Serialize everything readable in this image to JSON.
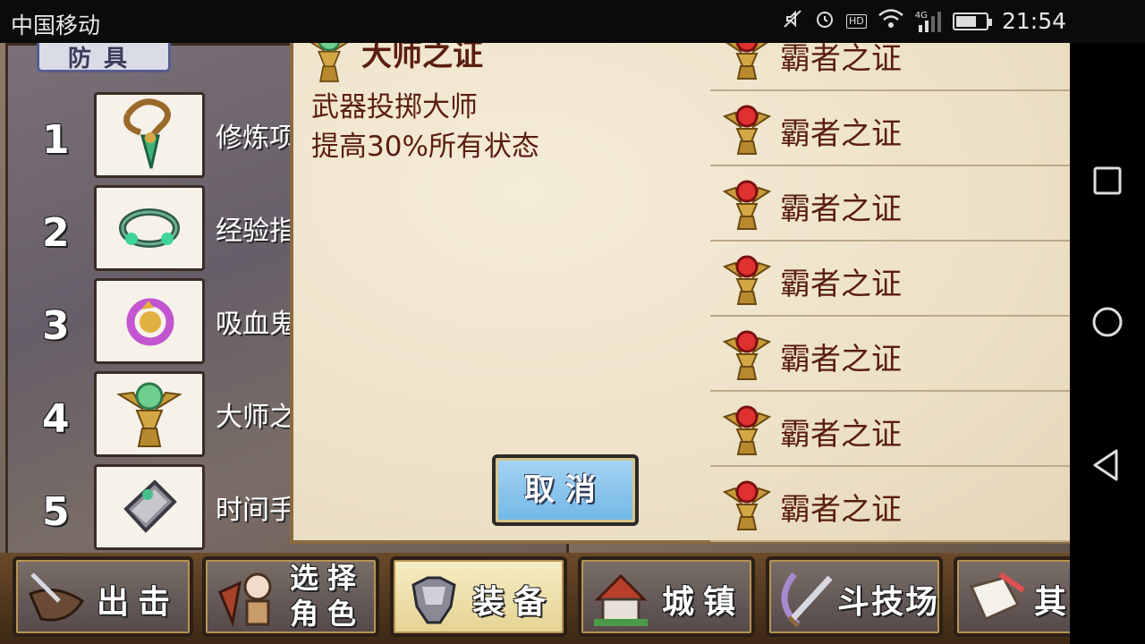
{
  "status_bar": {
    "carrier": "中国移动",
    "network": "4G",
    "hd": "HD",
    "battery_level": 0.7,
    "time": "21:54"
  },
  "left_panel": {
    "tab_label": "防具",
    "slots": [
      {
        "num": "1",
        "name": "修炼项",
        "icon": "necklace-icon"
      },
      {
        "num": "2",
        "name": "经验指",
        "icon": "ring-icon"
      },
      {
        "num": "3",
        "name": "吸血鬼",
        "icon": "vampire-ring-icon"
      },
      {
        "num": "4",
        "name": "大师之",
        "icon": "master-emblem-icon"
      },
      {
        "num": "5",
        "name": "时间手",
        "icon": "bracelet-icon"
      }
    ]
  },
  "dialog": {
    "item_title": "大师之证",
    "description_lines": [
      "武器投掷大师",
      "提高30%所有状态"
    ],
    "cancel_label": "取消",
    "list_items": [
      "霸者之证",
      "霸者之证",
      "霸者之证",
      "霸者之证",
      "霸者之证",
      "霸者之证",
      "霸者之证"
    ]
  },
  "bottom_tabs": [
    {
      "label": "出击",
      "icon": "sortie-icon",
      "active": false
    },
    {
      "label_line1": "选择",
      "label_line2": "角色",
      "icon": "character-icon",
      "active": false
    },
    {
      "label": "装备",
      "icon": "armor-icon",
      "active": true
    },
    {
      "label": "城镇",
      "icon": "town-icon",
      "active": false
    },
    {
      "label": "斗技场",
      "icon": "arena-icon",
      "active": false
    },
    {
      "label": "其",
      "icon": "scroll-icon",
      "active": false
    }
  ],
  "colors": {
    "text_dark_red": "#5a1e10",
    "cancel_blue": "#70b7e6",
    "active_tab": "#f0e4b0"
  }
}
